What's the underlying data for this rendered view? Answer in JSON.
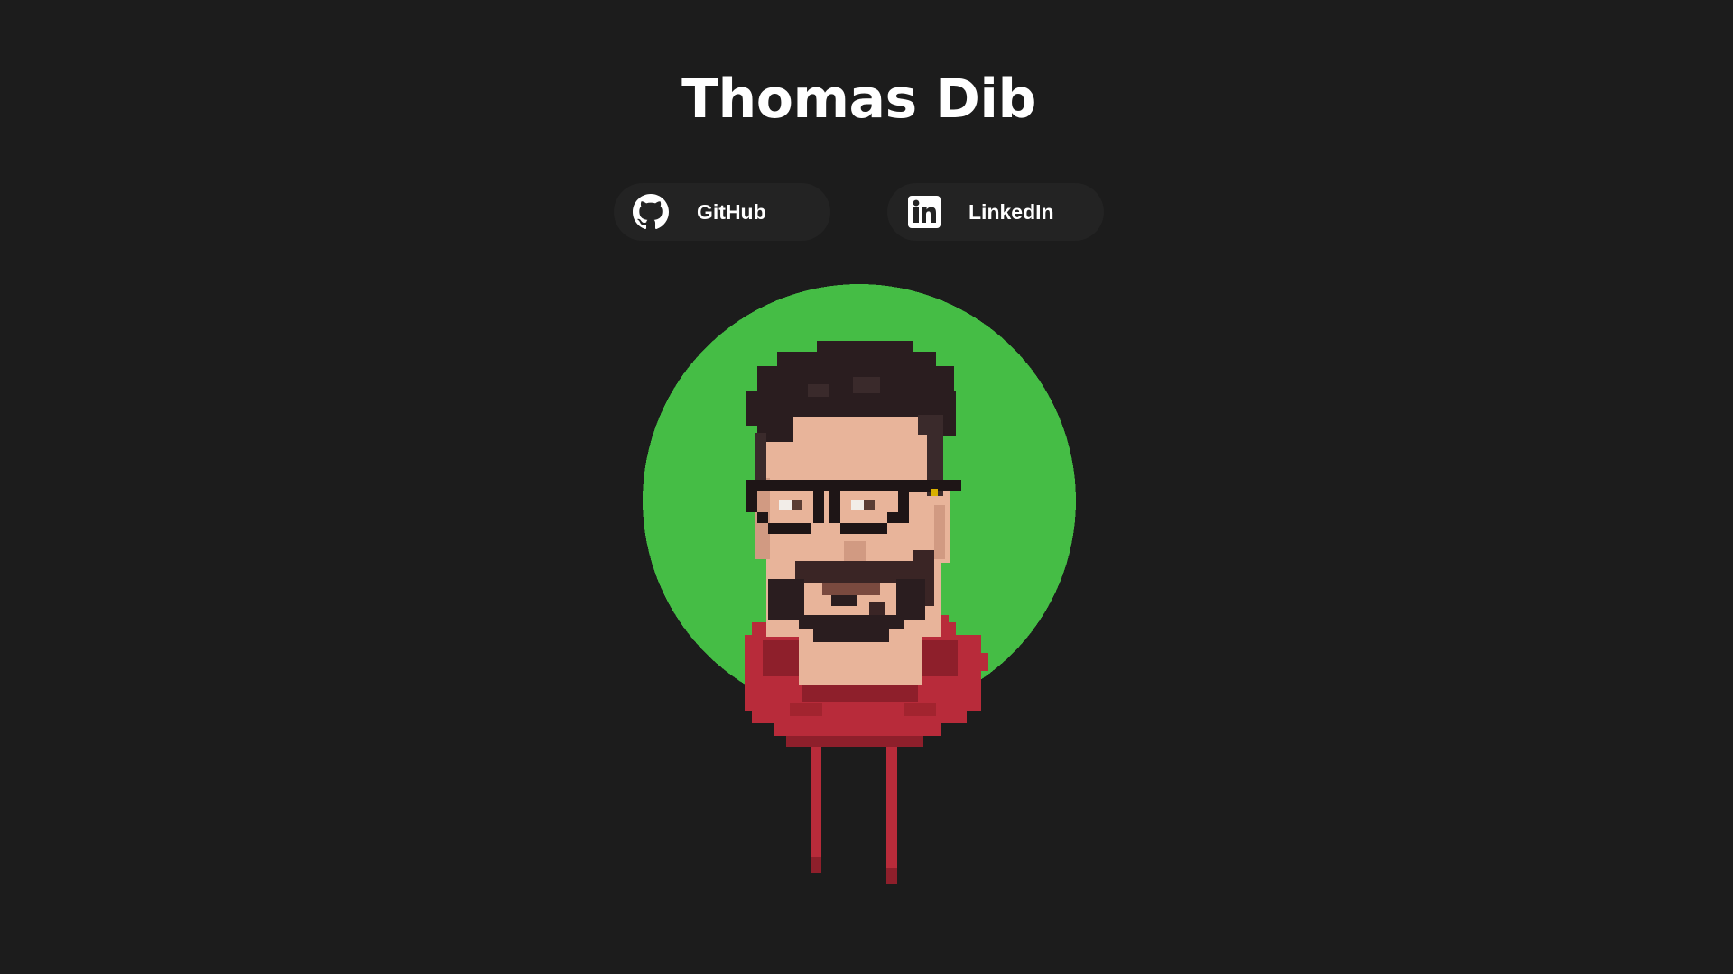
{
  "header": {
    "name": "Thomas Dib"
  },
  "links": [
    {
      "label": "GitHub",
      "icon": "github-icon"
    },
    {
      "label": "LinkedIn",
      "icon": "linkedin-icon"
    }
  ],
  "avatar": {
    "icon": "pixel-art-portrait",
    "circle_color": "#45bd45"
  },
  "colors": {
    "background": "#1c1c1c",
    "button_background": "#232323",
    "text": "#ffffff",
    "hoodie": "#b82b3a",
    "hair": "#2a1d1f",
    "skin": "#e8b49a"
  }
}
